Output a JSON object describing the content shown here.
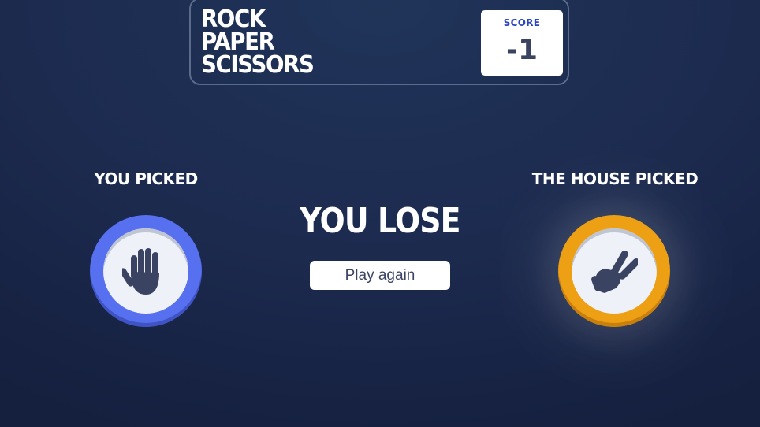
{
  "header": {
    "title_lines": [
      "ROCK",
      "PAPER",
      "SCISSORS"
    ],
    "score_label": "SCORE",
    "score_value": "-1"
  },
  "player": {
    "label": "YOU PICKED",
    "choice": "paper",
    "icon": "paper-hand-icon",
    "ring_color": "#5670f0"
  },
  "house": {
    "label": "THE HOUSE PICKED",
    "choice": "scissors",
    "icon": "scissors-hand-icon",
    "ring_color": "#eea015"
  },
  "result": {
    "text": "YOU LOSE",
    "button_label": "Play again"
  }
}
